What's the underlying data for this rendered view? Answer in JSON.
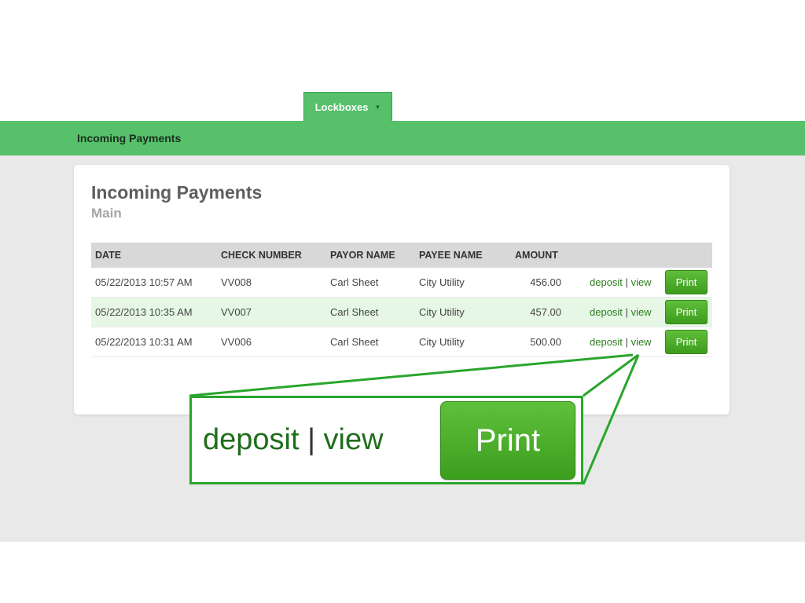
{
  "nav": {
    "tab_label": "Lockboxes",
    "tab_caret": "▼"
  },
  "bar": {
    "title": "Incoming Payments"
  },
  "card": {
    "title": "Incoming Payments",
    "subtitle": "Main"
  },
  "table": {
    "headers": {
      "date": "DATE",
      "check_number": "CHECK NUMBER",
      "payor_name": "PAYOR NAME",
      "payee_name": "PAYEE NAME",
      "amount": "AMOUNT"
    },
    "rows": [
      {
        "date": "05/22/2013 10:57 AM",
        "check_number": "VV008",
        "payor_name": "Carl Sheet",
        "payee_name": "City Utility",
        "amount": "456.00"
      },
      {
        "date": "05/22/2013 10:35 AM",
        "check_number": "VV007",
        "payor_name": "Carl Sheet",
        "payee_name": "City Utility",
        "amount": "457.00"
      },
      {
        "date": "05/22/2013 10:31 AM",
        "check_number": "VV006",
        "payor_name": "Carl Sheet",
        "payee_name": "City Utility",
        "amount": "500.00"
      }
    ],
    "actions": {
      "deposit": "deposit",
      "separator": "|",
      "view": "view",
      "print": "Print"
    }
  },
  "callout": {
    "deposit": "deposit",
    "separator": "|",
    "view": "view",
    "print": "Print"
  },
  "colors": {
    "brand_green": "#56c06a",
    "button_green": "#4cae2a",
    "link_green": "#2e7d1f",
    "callout_border": "#2aa52d",
    "alt_row": "#e6f7e5"
  }
}
